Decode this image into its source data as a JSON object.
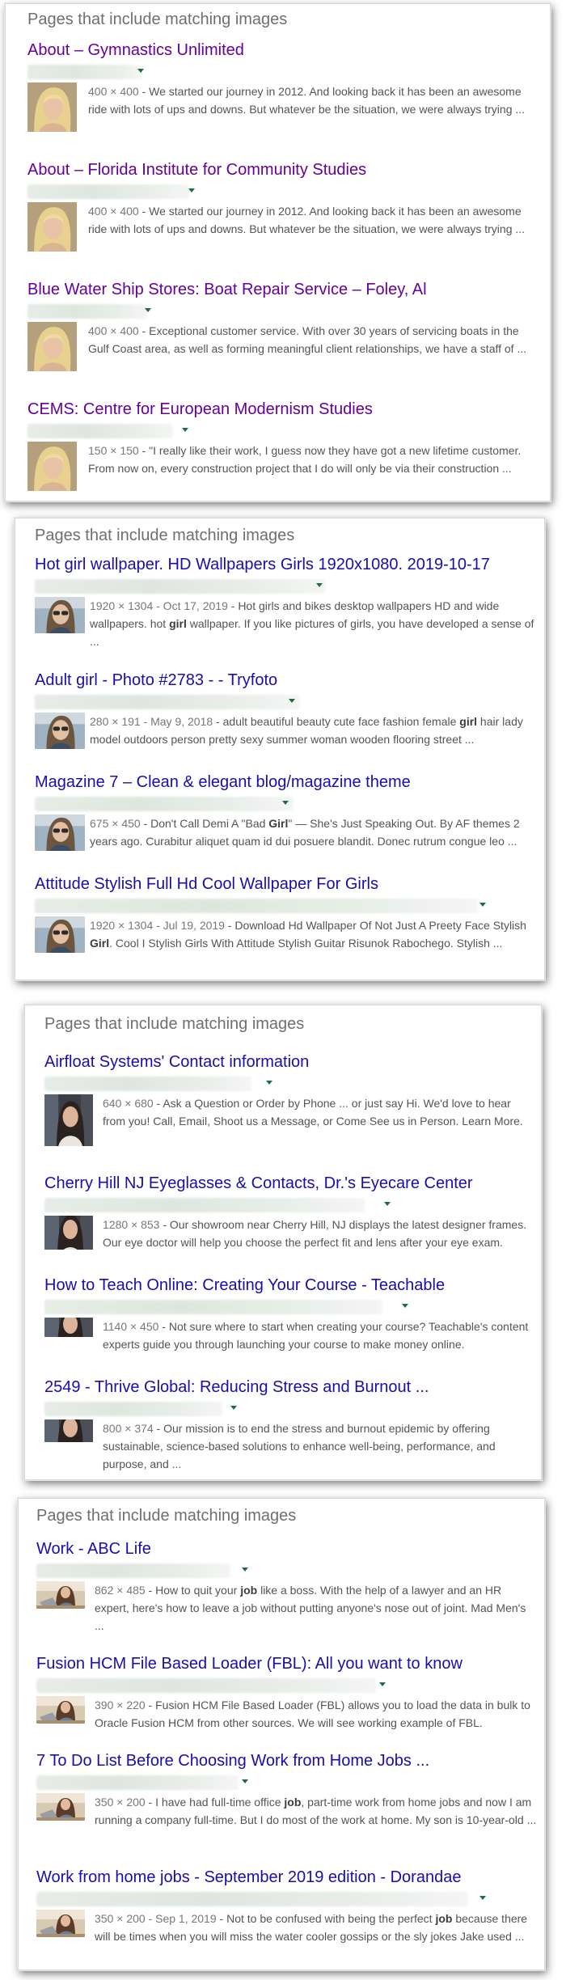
{
  "panels": [
    {
      "heading": "Pages that include matching images",
      "results": [
        {
          "title": "About – Gymnastics Unlimited",
          "visited": true,
          "dims": "400 × 400",
          "snippet": "We started our journey in 2012. And looking back it has been an awesome ride with lots of ups and downs. But whatever be the situation, we were always trying ...",
          "thumb": "blonde-portrait"
        },
        {
          "title": "About – Florida Institute for Community Studies",
          "visited": true,
          "dims": "400 × 400",
          "snippet": "We started our journey in 2012. And looking back it has been an awesome ride with lots of ups and downs. But whatever be the situation, we were always trying ...",
          "thumb": "blonde-portrait"
        },
        {
          "title": "Blue Water Ship Stores: Boat Repair Service – Foley, Al",
          "visited": true,
          "dims": "400 × 400",
          "snippet": "Exceptional customer service. With over 30 years of servicing boats in the Gulf Coast area, as well as forming meaningful client relationships, we have a staff of ...",
          "thumb": "blonde-portrait"
        },
        {
          "title": "CEMS: Centre for European Modernism Studies",
          "visited": true,
          "dims": "150 × 150",
          "snippet": "\"I really like their work, I guess now they have got a new lifetime customer. From now on, every construction project that I do will only be via their construction ...",
          "thumb": "blonde-portrait"
        }
      ]
    },
    {
      "heading": "Pages that include matching images",
      "results": [
        {
          "title": "Hot girl wallpaper. HD Wallpapers Girls 1920x1080. 2019-10-17",
          "visited": false,
          "dims": "1920 × 1304 - Oct 17, 2019",
          "snippet_pre": "Hot girls and bikes desktop wallpapers HD and wide wallpapers. hot ",
          "bold": "girl",
          "snippet_post": " wallpaper. If you like pictures of girls, you have developed a sense of ...",
          "thumb": "sunglasses-woman"
        },
        {
          "title": "Adult girl - Photo #2783 - - Tryfoto",
          "visited": false,
          "dims": "280 × 191 - May 9, 2018",
          "snippet_pre": "adult beautiful beauty cute face fashion female ",
          "bold": "girl",
          "snippet_post": " hair lady model outdoors person pretty sexy summer woman wooden flooring street ...",
          "thumb": "sunglasses-woman"
        },
        {
          "title": "Magazine 7 – Clean & elegant blog/magazine theme",
          "visited": false,
          "dims": "675 × 450",
          "snippet_pre": "Don't Call Demi A \"Bad ",
          "bold": "Girl",
          "snippet_post": "\" — She's Just Speaking Out. By AF themes 2 years ago. Curabitur aliquet quam id dui posuere blandit. Donec rutrum congue leo ...",
          "thumb": "sunglasses-woman"
        },
        {
          "title": "Attitude Stylish Full Hd Cool Wallpaper For Girls",
          "visited": false,
          "dims": "1920 × 1304 - Jul 19, 2019",
          "snippet_pre": "Download Hd Wallpaper Of Not Just A Preety Face Stylish ",
          "bold": "Girl",
          "snippet_post": ". Cool I Stylish Girls With Attitude Stylish Guitar Risunok Rabochego. Stylish ...",
          "thumb": "sunglasses-woman"
        }
      ]
    },
    {
      "heading": "Pages that include matching images",
      "results": [
        {
          "title": "Airfloat Systems' Contact information",
          "visited": false,
          "dims": "640 × 680",
          "snippet": "Ask a Question or Order by Phone ... or just say Hi. We'd love to hear from you! Call, Email, Shoot us a Message, or Come See us in Person. Learn More.",
          "thumb": "office-woman"
        },
        {
          "title": "Cherry Hill NJ Eyeglasses & Contacts, Dr.'s Eyecare Center",
          "visited": false,
          "dims": "1280 × 853",
          "snippet": "Our showroom near Cherry Hill, NJ displays the latest designer frames. Our eye doctor will help you choose the perfect fit and lens after your eye exam.",
          "thumb": "office-woman"
        },
        {
          "title": "How to Teach Online: Creating Your Course - Teachable",
          "visited": false,
          "dims": "1140 × 450",
          "snippet": "Not sure where to start when creating your course? Teachable's content experts guide you through launching your course to make money online.",
          "thumb": "office-woman"
        },
        {
          "title": "2549 - Thrive Global: Reducing Stress and Burnout ...",
          "visited": false,
          "dims": "800 × 374",
          "snippet": "Our mission is to end the stress and burnout epidemic by offering sustainable, science-based solutions to enhance well-being, performance, and purpose, and ...",
          "thumb": "office-woman"
        }
      ]
    },
    {
      "heading": "Pages that include matching images",
      "results": [
        {
          "title": "Work - ABC Life",
          "visited": false,
          "dims": "862 × 485",
          "snippet_pre": "How to quit your ",
          "bold": "job",
          "snippet_post": " like a boss. With the help of a lawyer and an HR expert, here's how to leave a job without putting anyone's nose out of joint. Mad Men's ...",
          "bold2_word": "job",
          "thumb": "laptop-woman"
        },
        {
          "title": "Fusion HCM File Based Loader (FBL): All you want to know",
          "visited": false,
          "dims": "390 × 220",
          "snippet": "Fusion HCM File Based Loader (FBL) allows you to load the data in bulk to Oracle Fusion HCM from other sources. We will see working example of FBL.",
          "thumb": "laptop-woman"
        },
        {
          "title": "7 To Do List Before Choosing Work from Home Jobs ...",
          "visited": false,
          "dims": "350 × 200",
          "snippet_pre": "I have had full-time office ",
          "bold": "job",
          "snippet_post": ", part-time work from home jobs and now I am running a company full-time. But I do most of the work at home. My son is 10-year-old ...",
          "thumb": "laptop-woman"
        },
        {
          "title": "Work from home jobs - September 2019 edition - Dorandae",
          "visited": false,
          "dims": "350 × 200 - Sep 1, 2019",
          "snippet_pre": "Not to be confused with being the perfect ",
          "bold": "job",
          "snippet_post": " because there will be times when you will miss the water cooler gossips or the sly jokes Jake used ...",
          "thumb": "laptop-woman"
        }
      ]
    }
  ],
  "colors": {
    "link": "#1a0dab",
    "visited_link": "#660099",
    "snippet": "#545454",
    "url_caret": "#1f6e43",
    "heading": "#6f6f6f"
  }
}
